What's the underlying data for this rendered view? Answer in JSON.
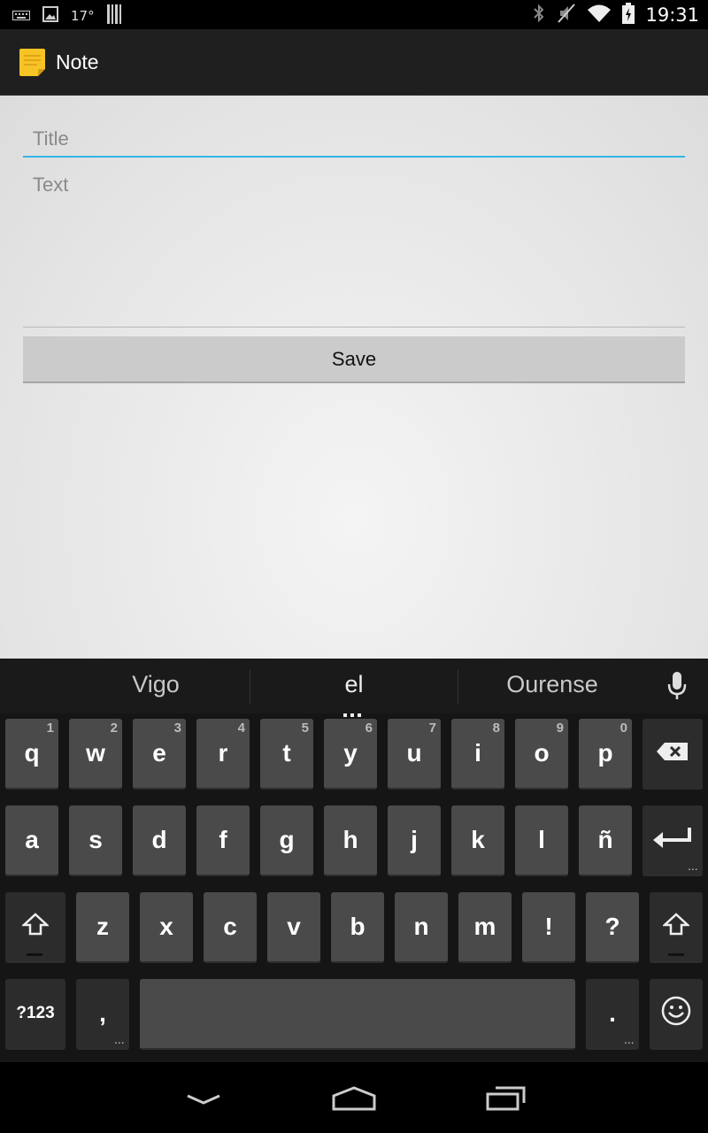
{
  "status_bar": {
    "temperature": "17°",
    "time": "19:31",
    "left_icons": [
      "keyboard-icon",
      "image-icon",
      "barcode-icon"
    ],
    "right_icons": [
      "bluetooth-icon",
      "mute-icon",
      "wifi-icon",
      "battery-icon"
    ]
  },
  "action_bar": {
    "title": "Note",
    "icon": "note-icon",
    "icon_color": "#f7c325"
  },
  "form": {
    "title_placeholder": "Title",
    "title_value": "",
    "text_placeholder": "Text",
    "text_value": "",
    "save_label": "Save",
    "accent_color": "#33b5e5"
  },
  "keyboard": {
    "suggestions": [
      "Vigo",
      "el",
      "Ourense"
    ],
    "row1": [
      {
        "label": "q",
        "hint": "1"
      },
      {
        "label": "w",
        "hint": "2"
      },
      {
        "label": "e",
        "hint": "3"
      },
      {
        "label": "r",
        "hint": "4"
      },
      {
        "label": "t",
        "hint": "5"
      },
      {
        "label": "y",
        "hint": "6"
      },
      {
        "label": "u",
        "hint": "7"
      },
      {
        "label": "i",
        "hint": "8"
      },
      {
        "label": "o",
        "hint": "9"
      },
      {
        "label": "p",
        "hint": "0"
      }
    ],
    "row2": [
      "a",
      "s",
      "d",
      "f",
      "g",
      "h",
      "j",
      "k",
      "l",
      "ñ"
    ],
    "row3": [
      "z",
      "x",
      "c",
      "v",
      "b",
      "n",
      "m",
      "!",
      "?"
    ],
    "symbols_label": "?123",
    "comma_label": ",",
    "period_label": ".",
    "more_marker": "..."
  },
  "nav_bar": {
    "icons": [
      "back-icon",
      "home-icon",
      "recents-icon"
    ]
  }
}
